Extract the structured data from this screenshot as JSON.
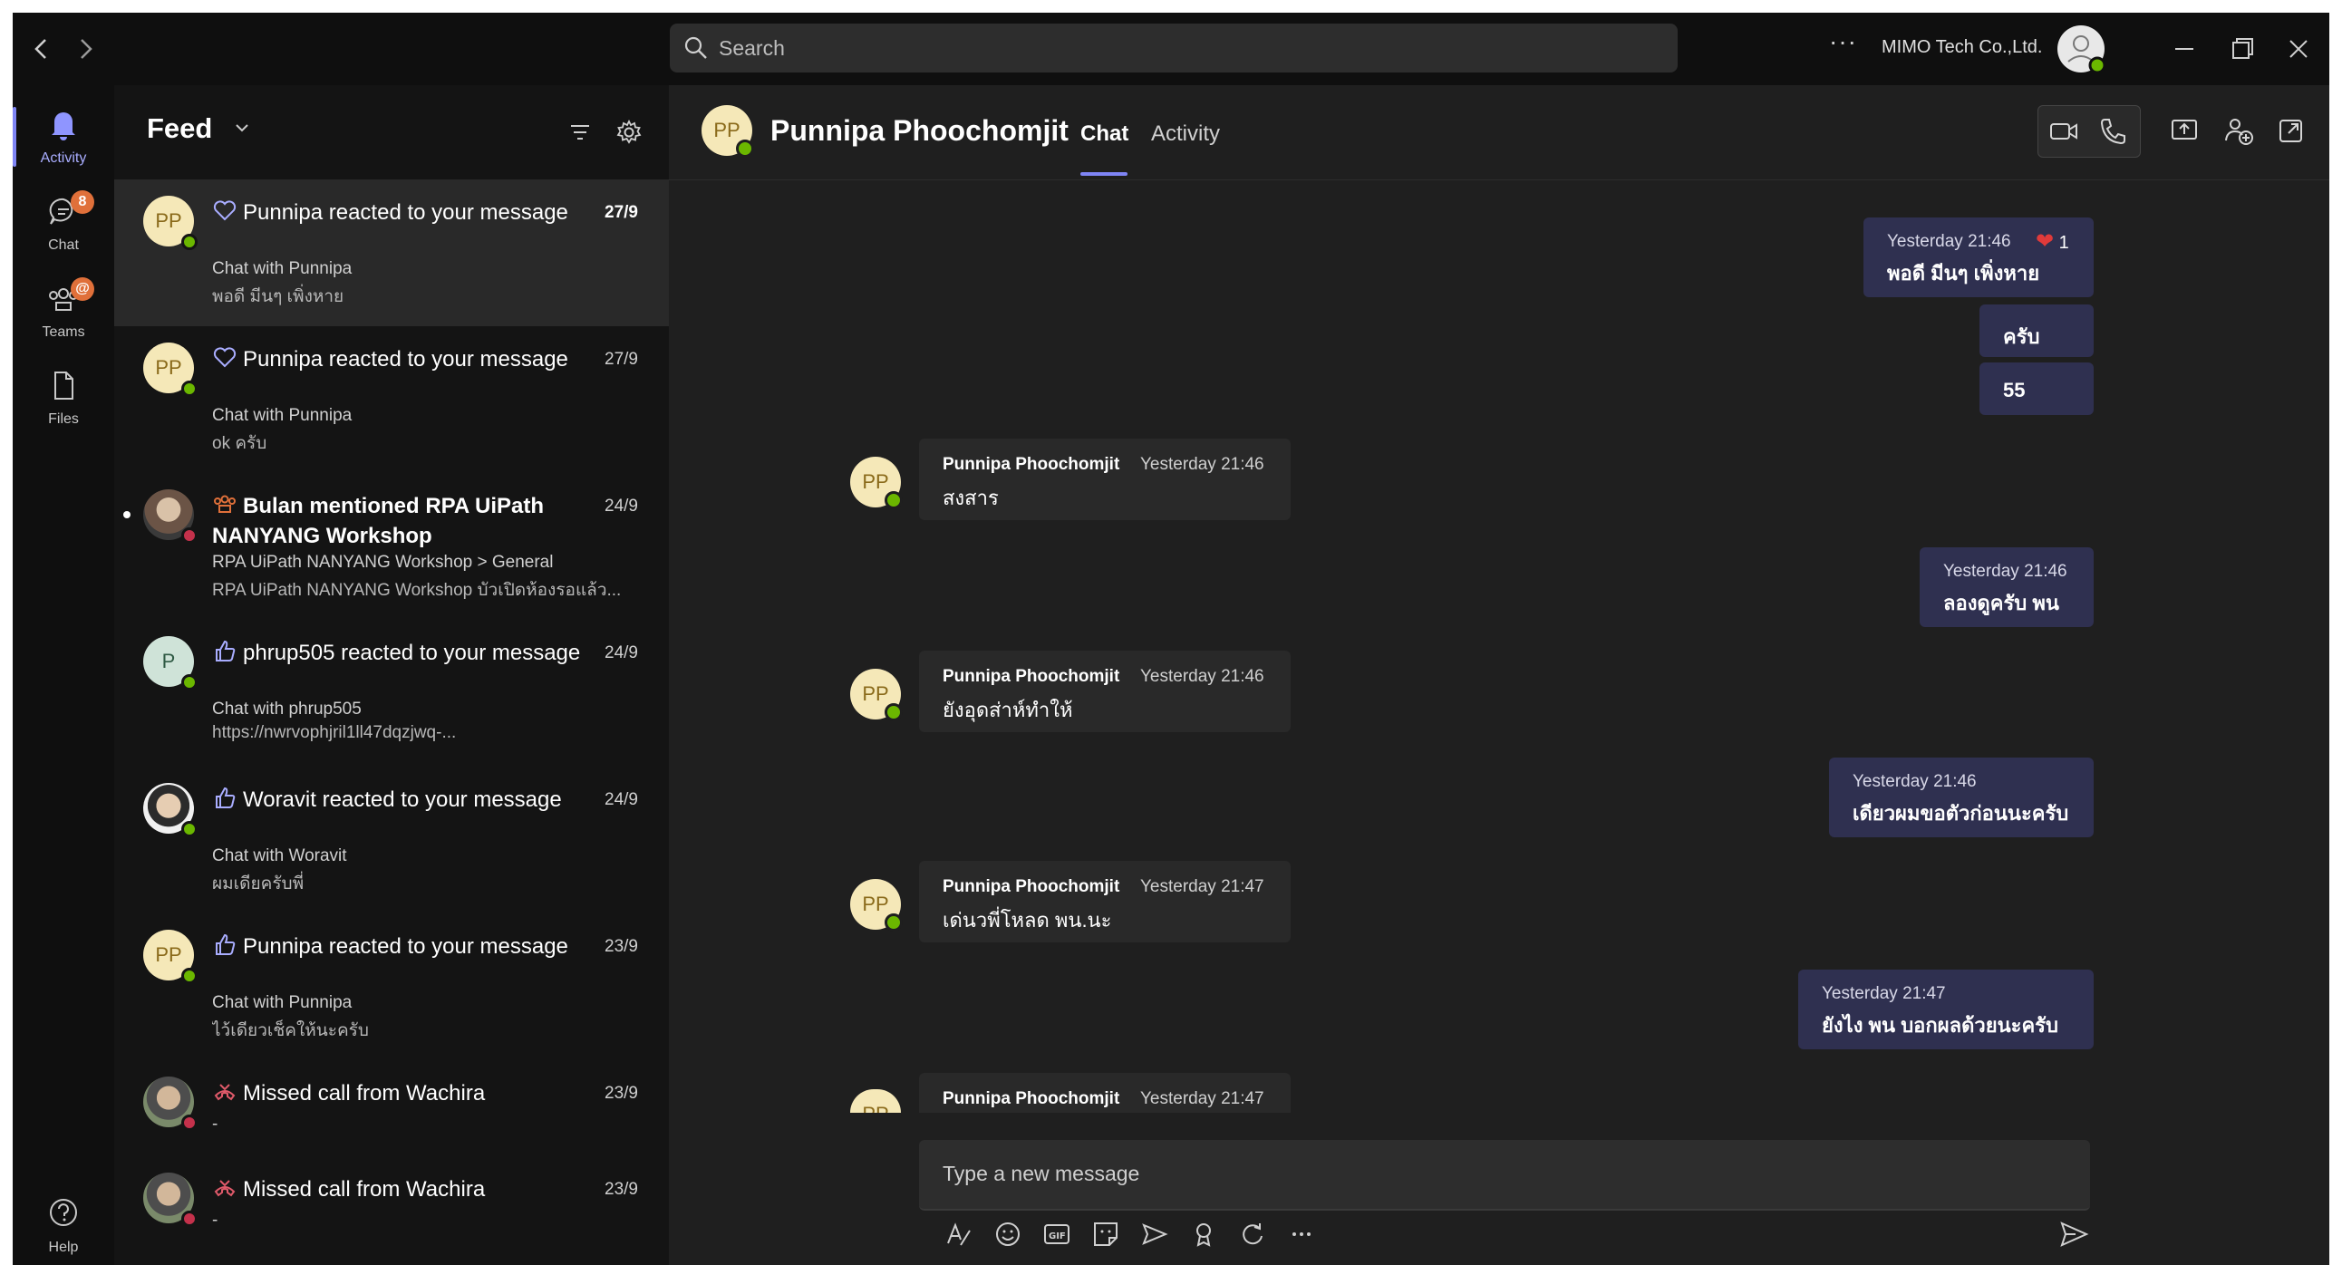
{
  "titlebar": {
    "search_placeholder": "Search",
    "more_label": "···",
    "org_name": "MIMO Tech Co.,Ltd.",
    "icons": [
      "back-arrow-icon",
      "forward-arrow-icon",
      "search-icon",
      "minimize-icon",
      "restore-icon",
      "close-icon"
    ]
  },
  "rail": {
    "items": [
      {
        "label": "Activity",
        "icon": "bell-icon",
        "active": true
      },
      {
        "label": "Chat",
        "icon": "chat-icon",
        "badge": "8"
      },
      {
        "label": "Teams",
        "icon": "teams-icon",
        "badge": "@"
      },
      {
        "label": "Files",
        "icon": "file-icon"
      }
    ],
    "help_label": "Help"
  },
  "feed": {
    "title": "Feed",
    "items": [
      {
        "avatar": "PP",
        "title": "Punnipa reacted to your message",
        "date": "27/9",
        "sub": "Chat with Punnipa",
        "preview": "พอดี มีนๆ เพิ่งหาย",
        "icon": "heart-outline-icon",
        "selected": true
      },
      {
        "avatar": "PP",
        "title": "Punnipa reacted to your message",
        "date": "27/9",
        "sub": "Chat with Punnipa",
        "preview": "ok ครับ",
        "icon": "heart-outline-icon"
      },
      {
        "avatar": "",
        "title": "Bulan mentioned RPA UiPath NANYANG Workshop",
        "date": "24/9",
        "sub": "RPA UiPath NANYANG Workshop > General",
        "preview": "RPA UiPath NANYANG Workshop บัวเปิดห้องรอแล้ว...",
        "icon": "mention-team-icon",
        "unread": true
      },
      {
        "avatar": "P",
        "title": "phrup505 reacted to your message",
        "date": "24/9",
        "sub": "Chat with phrup505",
        "preview": "https://nwrvophjril1ll47dqzjwq-...",
        "icon": "like-outline-icon"
      },
      {
        "avatar": "",
        "title": "Woravit reacted to your message",
        "date": "24/9",
        "sub": "Chat with Woravit",
        "preview": "ผมเดียครับพี่",
        "icon": "like-outline-icon"
      },
      {
        "avatar": "PP",
        "title": "Punnipa reacted to your message",
        "date": "23/9",
        "sub": "Chat with Punnipa",
        "preview": "ไว้เดียวเช็คให้นะครับ",
        "icon": "like-outline-icon"
      },
      {
        "avatar": "",
        "title": "Missed call from Wachira",
        "date": "23/9",
        "sub": "-",
        "preview": "",
        "icon": "missed-call-icon"
      },
      {
        "avatar": "",
        "title": "Missed call from Wachira",
        "date": "23/9",
        "sub": "-",
        "preview": "",
        "icon": "missed-call-icon"
      }
    ]
  },
  "chat": {
    "avatar": "PP",
    "name": "Punnipa Phoochomjit",
    "tabs": {
      "chat": "Chat",
      "activity": "Activity"
    },
    "messages": [
      {
        "dir": "out",
        "time": "Yesterday 21:46",
        "text": "พอดี มีนๆ เพิ่งหาย",
        "reaction_count": "1"
      },
      {
        "dir": "out",
        "text": "ครับ"
      },
      {
        "dir": "out",
        "text": "55"
      },
      {
        "dir": "in",
        "sender": "Punnipa Phoochomjit",
        "time": "Yesterday 21:46",
        "text": "สงสาร"
      },
      {
        "dir": "out",
        "time": "Yesterday 21:46",
        "text": "ลองดูครับ พน"
      },
      {
        "dir": "in",
        "sender": "Punnipa Phoochomjit",
        "time": "Yesterday 21:46",
        "text": "ยังอุดส่าห์ทำให้"
      },
      {
        "dir": "out",
        "time": "Yesterday 21:46",
        "text": "เดียวผมขอตัวก่อนนะครับ"
      },
      {
        "dir": "in",
        "sender": "Punnipa Phoochomjit",
        "time": "Yesterday 21:47",
        "text": "เด่นวพี่โหลด พน.นะ"
      },
      {
        "dir": "out",
        "time": "Yesterday 21:47",
        "text": "ยังไง พน บอกผลด้วยนะครับ"
      },
      {
        "dir": "in",
        "sender": "Punnipa Phoochomjit",
        "time": "Yesterday 21:47",
        "text": ""
      }
    ],
    "compose_placeholder": "Type a new message",
    "toolbar_icons": [
      "format-icon",
      "emoji-icon",
      "gif-icon",
      "sticker-icon",
      "schedule-send-icon",
      "praise-icon",
      "loop-icon",
      "more-icon",
      "send-icon"
    ],
    "header_icons": [
      "video-call-icon",
      "audio-call-icon",
      "share-screen-icon",
      "add-people-icon",
      "pop-out-icon"
    ]
  },
  "colors": {
    "accent": "#7f85f5",
    "online": "#6bb700",
    "busy": "#c4314b",
    "badge": "#e0703a",
    "outgoing_bubble": "#2f3050"
  }
}
